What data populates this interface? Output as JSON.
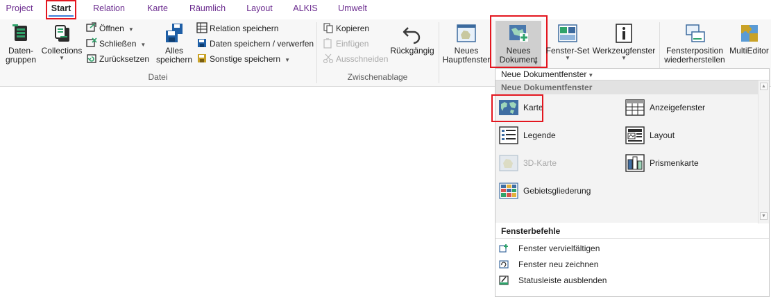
{
  "tabs": [
    {
      "label": "Project"
    },
    {
      "label": "Start"
    },
    {
      "label": "Relation"
    },
    {
      "label": "Karte"
    },
    {
      "label": "Räumlich"
    },
    {
      "label": "Layout"
    },
    {
      "label": "ALKIS"
    },
    {
      "label": "Umwelt"
    }
  ],
  "active_tab": "Start",
  "ribbon": {
    "groups": {
      "datei": "Datei",
      "zwischenablage": "Zwischenablage"
    },
    "daten_gruppen": {
      "line1": "Daten-",
      "line2": "gruppen"
    },
    "collections": "Collections",
    "oeffnen": "Öffnen",
    "schliessen": "Schließen",
    "zuruecksetzen": "Zurücksetzen",
    "alles_speichern": {
      "line1": "Alles",
      "line2": "speichern"
    },
    "relation_speichern": "Relation speichern",
    "daten_speichern": "Daten speichern / verwerfen",
    "sonstige_speichern": "Sonstige speichern",
    "kopieren": "Kopieren",
    "einfuegen": "Einfügen",
    "ausschneiden": "Ausschneiden",
    "rueckgaengig": "Rückgängig",
    "neues_hauptfenster": {
      "line1": "Neues",
      "line2": "Hauptfenster"
    },
    "neues_dokument": {
      "line1": "Neues",
      "line2": "Dokument"
    },
    "fenster_set": "Fenster-Set",
    "werkzeugfenster": "Werkzeugfenster",
    "fensterposition": {
      "line1": "Fensterposition",
      "line2": "wiederherstellen"
    },
    "multieditor": "MultiEditor"
  },
  "dropdown": {
    "title": "Neue Dokumentfenster",
    "gallery_header": "Neue Dokumentfenster",
    "items": {
      "karte": "Karte",
      "anzeigefenster": "Anzeigefenster",
      "legende": "Legende",
      "layout": "Layout",
      "karte3d": "3D-Karte",
      "prismenkarte": "Prismenkarte",
      "gebietsgliederung": "Gebietsgliederung"
    },
    "fensterbefehle_header": "Fensterbefehle",
    "commands": {
      "vervielfaeltigen": "Fenster vervielfältigen",
      "neu_zeichnen": "Fenster neu zeichnen",
      "statusleiste": "Statusleiste ausblenden"
    }
  },
  "colors": {
    "highlight": "#e3161f",
    "tab_text": "#6a2a8e",
    "active_underline": "#3b7bd8"
  }
}
